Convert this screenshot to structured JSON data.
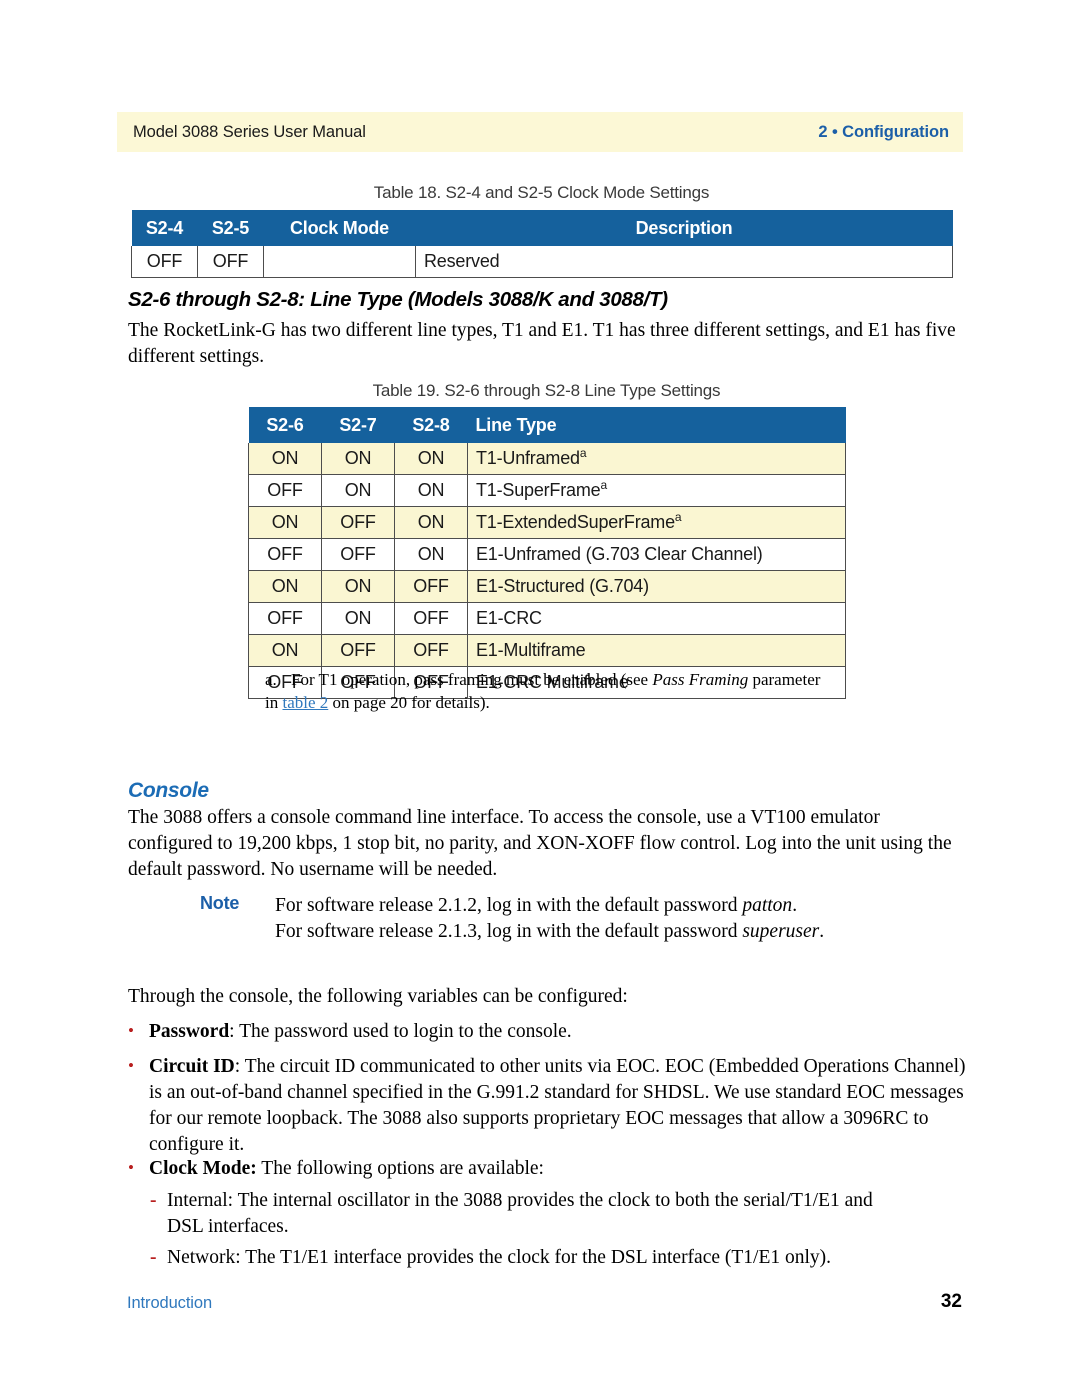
{
  "header": {
    "left": "Model 3088 Series User Manual",
    "right": "2 • Configuration",
    "band_color": "#FCF8D6",
    "accent_blue": "#1C5FA8"
  },
  "table18": {
    "caption": "Table 18. S2-4 and S2-5 Clock Mode Settings",
    "columns": [
      "S2-4",
      "S2-5",
      "Clock Mode",
      "Description"
    ],
    "rows": [
      {
        "s2_4": "OFF",
        "s2_5": "OFF",
        "clock_mode": "",
        "description": "Reserved"
      }
    ],
    "header_bg": "#15619D",
    "header_fg": "#FFFFFF"
  },
  "section1": {
    "heading": "S2-6 through S2-8: Line Type (Models 3088/K and 3088/T)",
    "paragraph": "The RocketLink-G has two different line types, T1 and E1. T1 has three different settings, and E1 has five different settings."
  },
  "table19": {
    "caption": "Table 19. S2-6 through S2-8 Line Type Settings",
    "columns": [
      "S2-6",
      "S2-7",
      "S2-8",
      "Line Type"
    ],
    "rows": [
      {
        "s2_6": "ON",
        "s2_7": "ON",
        "s2_8": "ON",
        "line_type": "T1-Unframed",
        "footnote": "a",
        "highlight": true
      },
      {
        "s2_6": "OFF",
        "s2_7": "ON",
        "s2_8": "ON",
        "line_type": "T1-SuperFrame",
        "footnote": "a",
        "highlight": false
      },
      {
        "s2_6": "ON",
        "s2_7": "OFF",
        "s2_8": "ON",
        "line_type": "T1-ExtendedSuperFrame",
        "footnote": "a",
        "highlight": true
      },
      {
        "s2_6": "OFF",
        "s2_7": "OFF",
        "s2_8": "ON",
        "line_type": "E1-Unframed (G.703 Clear Channel)",
        "footnote": "",
        "highlight": false
      },
      {
        "s2_6": "ON",
        "s2_7": "ON",
        "s2_8": "OFF",
        "line_type": "E1-Structured (G.704)",
        "footnote": "",
        "highlight": true
      },
      {
        "s2_6": "OFF",
        "s2_7": "ON",
        "s2_8": "OFF",
        "line_type": "E1-CRC",
        "footnote": "",
        "highlight": false
      },
      {
        "s2_6": "ON",
        "s2_7": "OFF",
        "s2_8": "OFF",
        "line_type": "E1-Multiframe",
        "footnote": "",
        "highlight": true
      },
      {
        "s2_6": "OFF",
        "s2_7": "OFF",
        "s2_8": "OFF",
        "line_type": "E1-CRC Multiframe",
        "footnote": "",
        "highlight": false
      }
    ],
    "header_bg": "#15619D",
    "row_highlight": "#FAF6D2"
  },
  "footnote": {
    "marker": "a.",
    "part1": "For T1 operation, pass framing must be enabled (see ",
    "italic1": "Pass Framing",
    "part2": " parameter in ",
    "link": "table 2",
    "part3": " on page 20 for details).",
    "link_color": "#2F78BD"
  },
  "console": {
    "heading": "Console",
    "paragraph": "The 3088 offers a console command line interface. To access the console, use a VT100 emulator configured to 19,200 kbps, 1 stop bit, no parity, and XON-XOFF flow control. Log into the unit using the default password. No username will be needed."
  },
  "note": {
    "label": "Note",
    "line1_part1": "For software release 2.1.2, log in with the default password ",
    "line1_italic": "patton",
    "line1_part2": ".",
    "line2_part1": "For software release 2.1.3, log in with the default password ",
    "line2_italic": "superuser",
    "line2_part2": "."
  },
  "variables": {
    "intro": "Through the console, the following variables can be configured:",
    "bullets": [
      {
        "label": "Password",
        "sep": ":",
        "text": " The password used to login to the console."
      },
      {
        "label": "Circuit ID",
        "sep": ":",
        "text": " The circuit ID communicated to other units via EOC. EOC (Embedded Operations Channel) is an out-of-band channel specified in the G.991.2 standard for SHDSL. We use standard EOC messages for our remote loopback. The 3088 also supports proprietary EOC messages that allow a 3096RC to configure it."
      },
      {
        "label": "Clock Mode:",
        "sep": "",
        "text": " The following options are available:"
      }
    ],
    "sub_bullets": [
      "Internal: The internal oscillator in the 3088 provides the clock to both the serial/T1/E1 and DSL interfaces.",
      "Network: The T1/E1 interface provides the clock for the DSL interface (T1/E1 only)."
    ],
    "bullet_glyph": "•",
    "sub_glyph": "-",
    "bullet_color": "#B81F1F"
  },
  "footer": {
    "left": "Introduction",
    "page_number": "32",
    "left_color": "#2F78BD"
  }
}
